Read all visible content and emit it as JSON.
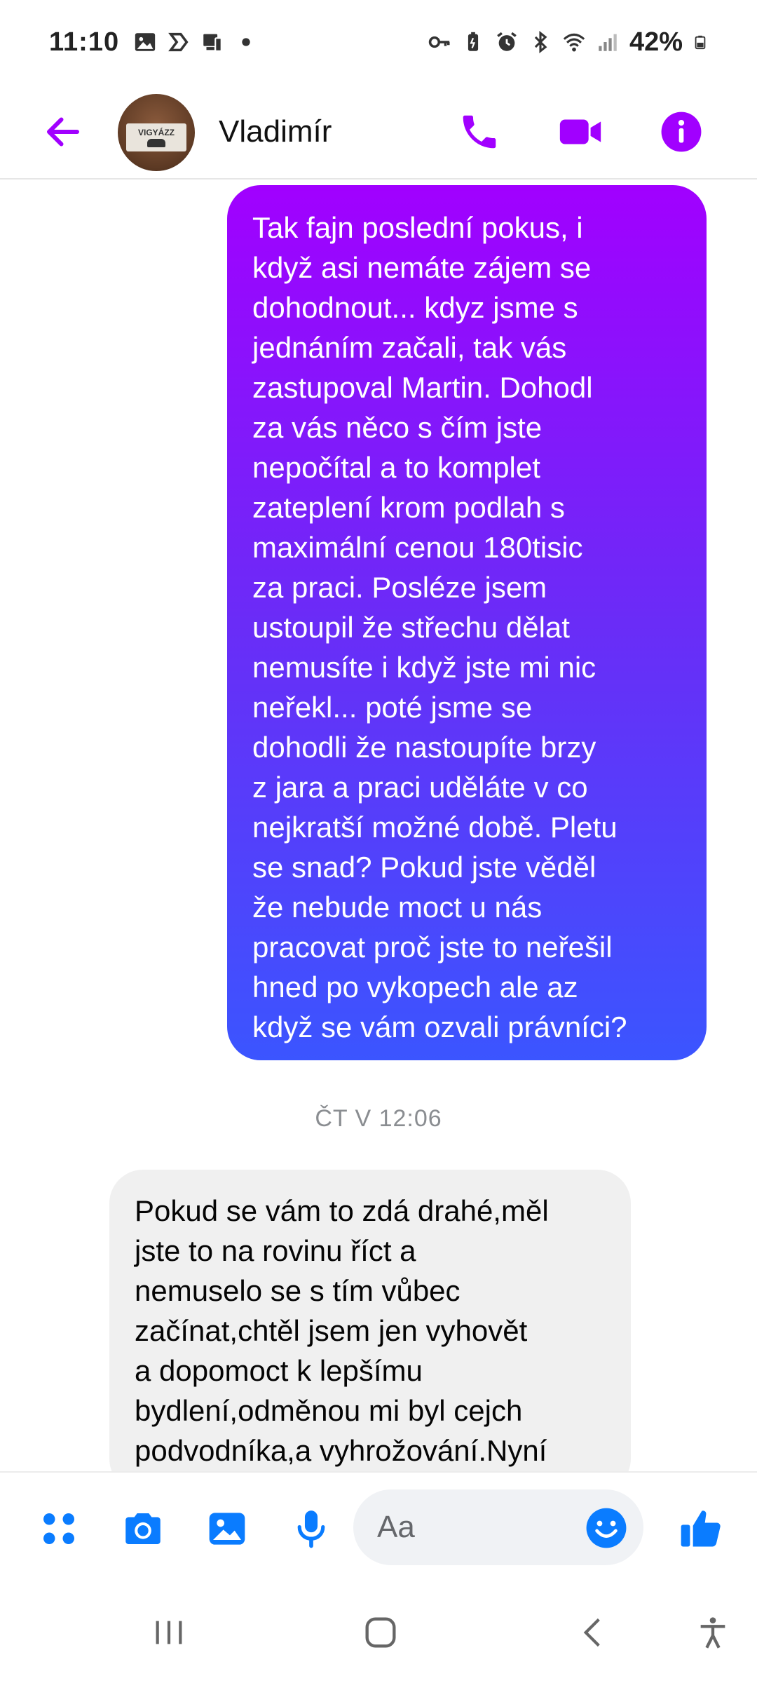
{
  "status_bar": {
    "time": "11:10",
    "battery": "42%"
  },
  "header": {
    "contact_name": "Vladimír",
    "avatar_text": "VIGYÁZZ",
    "accent_color": "#a100ff"
  },
  "chat": {
    "messages": [
      {
        "direction": "outgoing",
        "text": "Tak fajn poslední pokus, i\nkdyž asi nemáte zájem se\ndohodnout... kdyz jsme s\njednáním začali, tak vás\nzastupoval Martin. Dohodl\nza vás něco s čím jste\nnepočítal a to komplet\nzateplení krom podlah s\nmaximální cenou 180tisic\nza praci. Posléze jsem\nustoupil že střechu dělat\nnemusíte i když jste mi nic\nneřekl... poté jsme se\ndohodli že nastoupíte brzy\nz jara a praci uděláte v co\nnejkratší možné době. Pletu\nse snad?  Pokud jste věděl\nže nebude moct u nás\npracovat proč jste to neřešil\nhned po vykopech ale az\nkdyž se vám ozvali právníci?"
      },
      {
        "direction": "incoming",
        "text": "Pokud se vám to zdá drahé,měl\njste to na rovinu říct a\nnemuselo se s tím vůbec\nzačínat,chtěl jsem jen vyhovět\na dopomoct k lepšímu\nbydlení,odměnou mi byl cejch\npodvodníka,a vyhrožování.Nyní"
      }
    ],
    "timestamp": "ČT V 12:06"
  },
  "composer": {
    "placeholder": "Aa"
  },
  "icons": {
    "back": "arrow-left-icon",
    "call": "phone-icon",
    "video": "video-camera-icon",
    "info": "info-icon",
    "menu": "four-dots-icon",
    "camera": "camera-icon",
    "gallery": "image-icon",
    "mic": "microphone-icon",
    "emoji": "smiley-icon",
    "like": "thumbs-up-icon"
  }
}
